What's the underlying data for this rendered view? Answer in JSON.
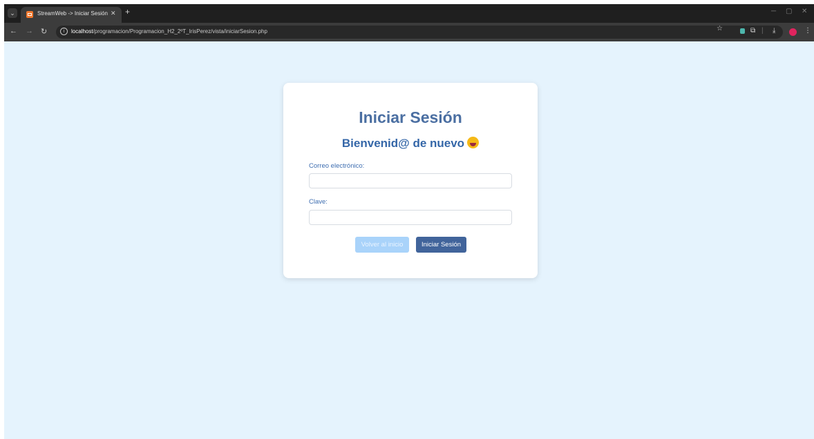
{
  "browser": {
    "tab_title": "StreamWeb -> Iniciar Sesión",
    "url_host": "localhost",
    "url_path": "/programacion/Programacion_H2_2ºT_IrisPerez/vista/iniciarSesion.php",
    "profile_color": "#e0245e"
  },
  "page": {
    "title": "Iniciar Sesión",
    "subtitle": "Bienvenid@ de nuevo",
    "email_label": "Correo electrónico:",
    "email_value": "",
    "password_label": "Clave:",
    "password_value": "",
    "back_button": "Volver al inicio",
    "login_button": "Iniciar Sesión",
    "background_color": "#e5f3fd",
    "accent_color": "#41649b"
  }
}
